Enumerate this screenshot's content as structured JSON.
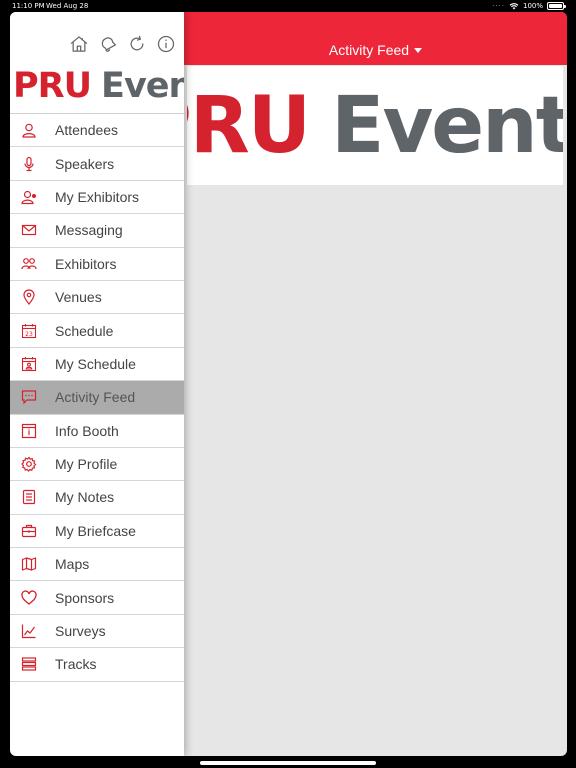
{
  "status_bar": {
    "time": "11:10 PM",
    "date": "Wed Aug 28",
    "battery": "100%",
    "battery_level": 1.0
  },
  "sidebar": {
    "toolbar_icons": [
      "home-icon",
      "bell-icon",
      "refresh-icon",
      "info-icon"
    ],
    "logo": {
      "part1": "PRU",
      "part2": "Events"
    },
    "items": [
      {
        "label": "Attendees",
        "icon": "person-icon"
      },
      {
        "label": "Speakers",
        "icon": "microphone-icon"
      },
      {
        "label": "My Exhibitors",
        "icon": "user-badge-icon"
      },
      {
        "label": "Messaging",
        "icon": "envelope-icon"
      },
      {
        "label": "Exhibitors",
        "icon": "group-icon"
      },
      {
        "label": "Venues",
        "icon": "map-pin-icon"
      },
      {
        "label": "Schedule",
        "icon": "calendar-icon"
      },
      {
        "label": "My Schedule",
        "icon": "calendar-person-icon"
      },
      {
        "label": "Activity Feed",
        "icon": "chat-bubble-icon",
        "active": true
      },
      {
        "label": "Info Booth",
        "icon": "info-box-icon"
      },
      {
        "label": "My Profile",
        "icon": "gear-icon"
      },
      {
        "label": "My Notes",
        "icon": "notes-icon"
      },
      {
        "label": "My Briefcase",
        "icon": "briefcase-icon"
      },
      {
        "label": "Maps",
        "icon": "map-icon"
      },
      {
        "label": "Sponsors",
        "icon": "heart-icon"
      },
      {
        "label": "Surveys",
        "icon": "chart-icon"
      },
      {
        "label": "Tracks",
        "icon": "layers-icon"
      }
    ]
  },
  "header": {
    "title": "Activity Feed"
  },
  "banner": {
    "part1": "PRU",
    "part2": "Events"
  },
  "colors": {
    "brand_red": "#ee2639",
    "logo_red": "#d4232e",
    "logo_gray": "#5f6468",
    "active_item": "#ababab",
    "content_bg": "#e6e6e6"
  }
}
